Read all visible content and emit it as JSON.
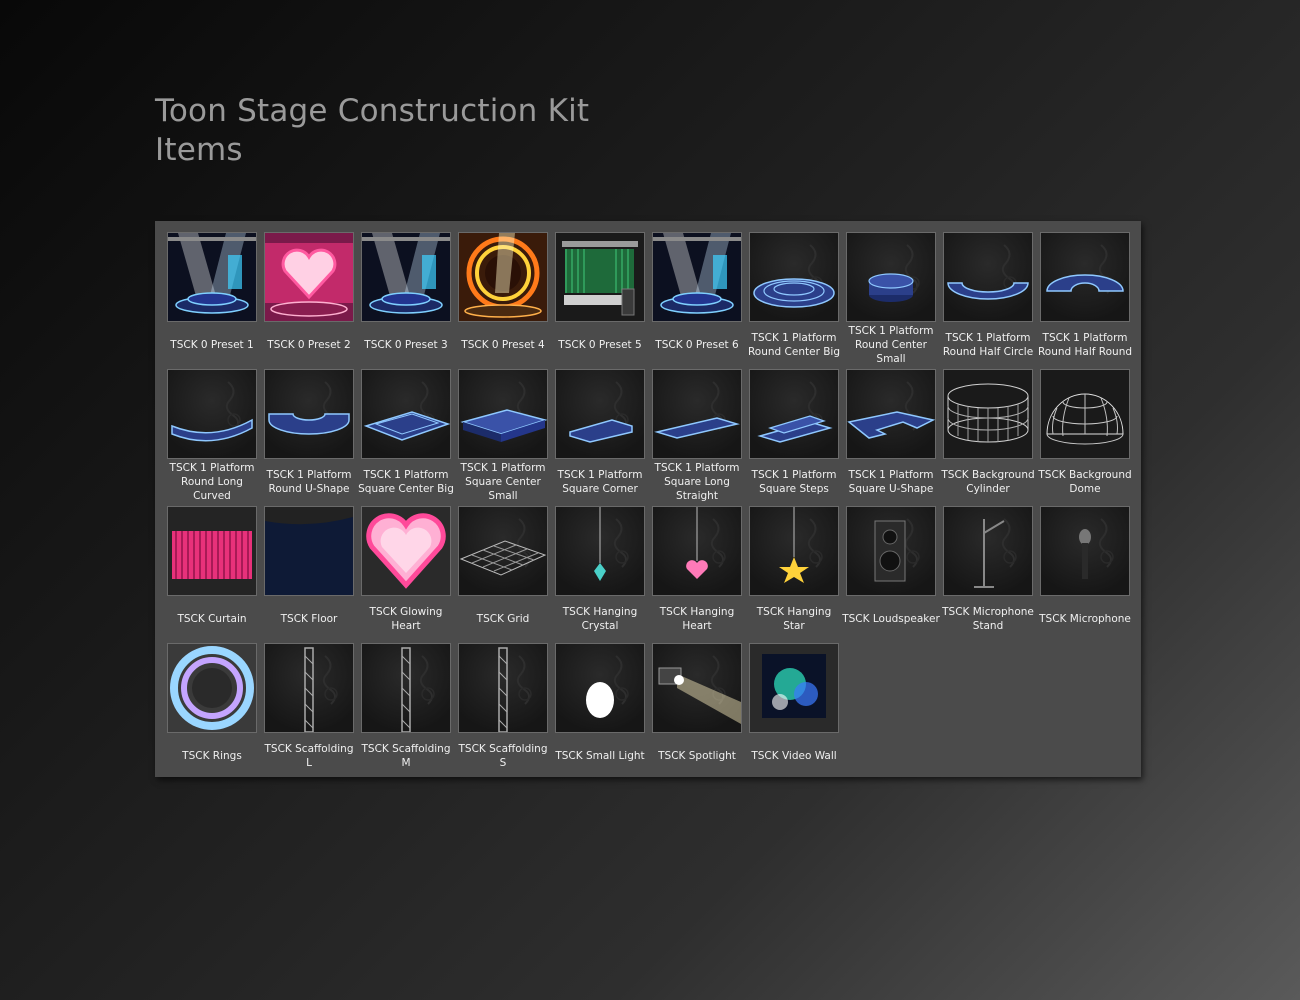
{
  "page": {
    "title_line1": "Toon Stage Construction Kit",
    "title_line2": "Items"
  },
  "items": [
    {
      "label": "TSCK 0 Preset 1",
      "icon": "stage-preset-icon"
    },
    {
      "label": "TSCK 0 Preset 2",
      "icon": "heart-stage-preset-icon"
    },
    {
      "label": "TSCK 0 Preset 3",
      "icon": "stage-preset-icon"
    },
    {
      "label": "TSCK 0 Preset 4",
      "icon": "ring-stage-preset-icon"
    },
    {
      "label": "TSCK 0 Preset 5",
      "icon": "curtain-stage-preset-icon"
    },
    {
      "label": "TSCK 0 Preset 6",
      "icon": "stage-preset-icon"
    },
    {
      "label": "TSCK 1 Platform Round Center Big",
      "icon": "round-platform-icon"
    },
    {
      "label": "TSCK 1 Platform Round Center Small",
      "icon": "round-platform-small-icon"
    },
    {
      "label": "TSCK 1 Platform Round Half Circle",
      "icon": "half-circle-platform-icon"
    },
    {
      "label": "TSCK 1 Platform Round Half Round",
      "icon": "half-round-platform-icon"
    },
    {
      "label": "TSCK 1 Platform Round Long Curved",
      "icon": "curved-platform-icon"
    },
    {
      "label": "TSCK 1 Platform Round U-Shape",
      "icon": "u-shape-round-platform-icon"
    },
    {
      "label": "TSCK 1 Platform Square Center Big",
      "icon": "square-platform-icon"
    },
    {
      "label": "TSCK 1 Platform Square Center Small",
      "icon": "square-platform-small-icon"
    },
    {
      "label": "TSCK 1 Platform Square Corner",
      "icon": "corner-platform-icon"
    },
    {
      "label": "TSCK 1 Platform Square Long Straight",
      "icon": "straight-platform-icon"
    },
    {
      "label": "TSCK 1 Platform Square Steps",
      "icon": "steps-platform-icon"
    },
    {
      "label": "TSCK 1 Platform Square U-Shape",
      "icon": "u-shape-square-platform-icon"
    },
    {
      "label": "TSCK Background Cylinder",
      "icon": "cylinder-icon"
    },
    {
      "label": "TSCK Background Dome",
      "icon": "dome-icon"
    },
    {
      "label": "TSCK Curtain",
      "icon": "curtain-icon"
    },
    {
      "label": "TSCK Floor",
      "icon": "floor-icon"
    },
    {
      "label": "TSCK Glowing Heart",
      "icon": "heart-icon"
    },
    {
      "label": "TSCK Grid",
      "icon": "grid-icon"
    },
    {
      "label": "TSCK Hanging Crystal",
      "icon": "crystal-icon"
    },
    {
      "label": "TSCK Hanging Heart",
      "icon": "hanging-heart-icon"
    },
    {
      "label": "TSCK Hanging Star",
      "icon": "star-icon"
    },
    {
      "label": "TSCK Loudspeaker",
      "icon": "speaker-icon"
    },
    {
      "label": "TSCK Microphone Stand",
      "icon": "mic-stand-icon"
    },
    {
      "label": "TSCK Microphone",
      "icon": "microphone-icon"
    },
    {
      "label": "TSCK Rings",
      "icon": "rings-icon"
    },
    {
      "label": "TSCK Scaffolding L",
      "icon": "scaffolding-icon"
    },
    {
      "label": "TSCK Scaffolding M",
      "icon": "scaffolding-icon"
    },
    {
      "label": "TSCK Scaffolding S",
      "icon": "scaffolding-icon"
    },
    {
      "label": "TSCK Small Light",
      "icon": "light-icon"
    },
    {
      "label": "TSCK Spotlight",
      "icon": "spotlight-icon"
    },
    {
      "label": "TSCK Video Wall",
      "icon": "video-wall-icon"
    }
  ],
  "colors": {
    "panel": "#4b4b4b",
    "title": "#9a9a9a",
    "label": "#f0f0f0",
    "platform_blue": "#2b3f8a",
    "platform_glow": "#8fc8ff",
    "pink": "#e8317a"
  }
}
